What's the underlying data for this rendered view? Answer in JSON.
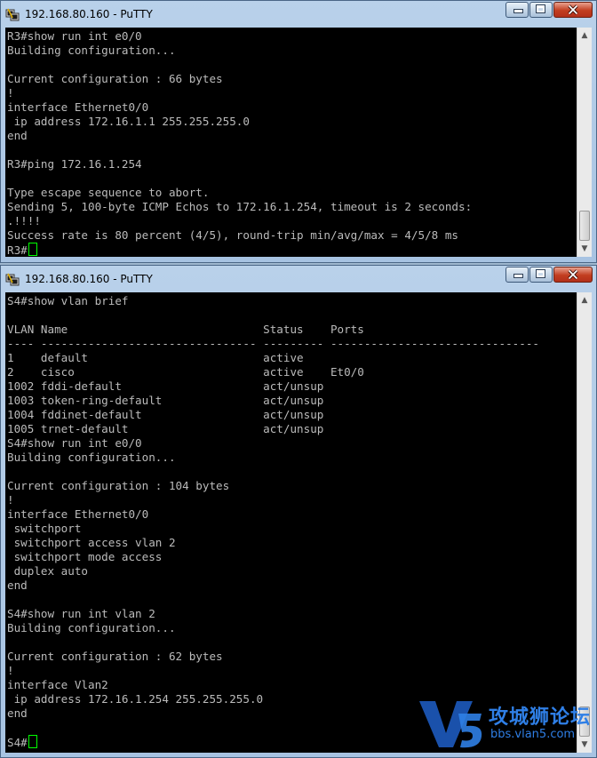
{
  "windows": [
    {
      "title": "192.168.80.160 - PuTTY",
      "lines": [
        "R3#show run int e0/0",
        "Building configuration...",
        "",
        "Current configuration : 66 bytes",
        "!",
        "interface Ethernet0/0",
        " ip address 172.16.1.1 255.255.255.0",
        "end",
        "",
        "R3#ping 172.16.1.254",
        "",
        "Type escape sequence to abort.",
        "Sending 5, 100-byte ICMP Echos to 172.16.1.254, timeout is 2 seconds:",
        ".!!!!",
        "Success rate is 80 percent (4/5), round-trip min/avg/max = 4/5/8 ms"
      ],
      "prompt": "R3#"
    },
    {
      "title": "192.168.80.160 - PuTTY",
      "lines": [
        "S4#show vlan brief",
        "",
        "VLAN Name                             Status    Ports",
        "---- -------------------------------- --------- -------------------------------",
        "1    default                          active",
        "2    cisco                            active    Et0/0",
        "1002 fddi-default                     act/unsup",
        "1003 token-ring-default               act/unsup",
        "1004 fddinet-default                  act/unsup",
        "1005 trnet-default                    act/unsup",
        "S4#show run int e0/0",
        "Building configuration...",
        "",
        "Current configuration : 104 bytes",
        "!",
        "interface Ethernet0/0",
        " switchport",
        " switchport access vlan 2",
        " switchport mode access",
        " duplex auto",
        "end",
        "",
        "S4#show run int vlan 2",
        "Building configuration...",
        "",
        "Current configuration : 62 bytes",
        "!",
        "interface Vlan2",
        " ip address 172.16.1.254 255.255.255.0",
        "end",
        ""
      ],
      "prompt": "S4#"
    }
  ],
  "watermark": {
    "text": "攻城狮论坛",
    "url": "bbs.vlan5.com"
  }
}
